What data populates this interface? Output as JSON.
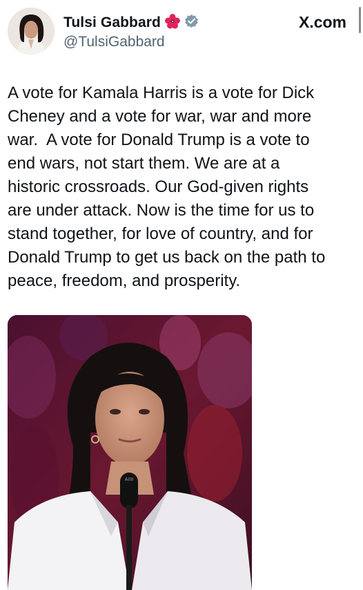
{
  "header": {
    "display_name": "Tulsi Gabbard",
    "handle": "@TulsiGabbard",
    "brand": "X.com",
    "name_emoji": "hibiscus-icon",
    "verified": "verified-badge-icon"
  },
  "tweet": {
    "text": "A vote for Kamala Harris is a vote for Dick\nCheney and a vote for war, war and more\nwar.  A vote for Donald Trump is a vote to\nend wars, not start them. We are at a\nhistoric crossroads. Our God-given rights\nare under attack. Now is the time for us to\nstand together, for love of country, and for\nDonald Trump to get us back on the path to\npeace, freedom, and prosperity."
  },
  "media": {
    "type": "video-still",
    "mic_label": "AIIII"
  },
  "colors": {
    "verified_badge": "#829aab",
    "hibiscus": "#e0245e",
    "handle": "#536471",
    "text": "#0f1419"
  }
}
